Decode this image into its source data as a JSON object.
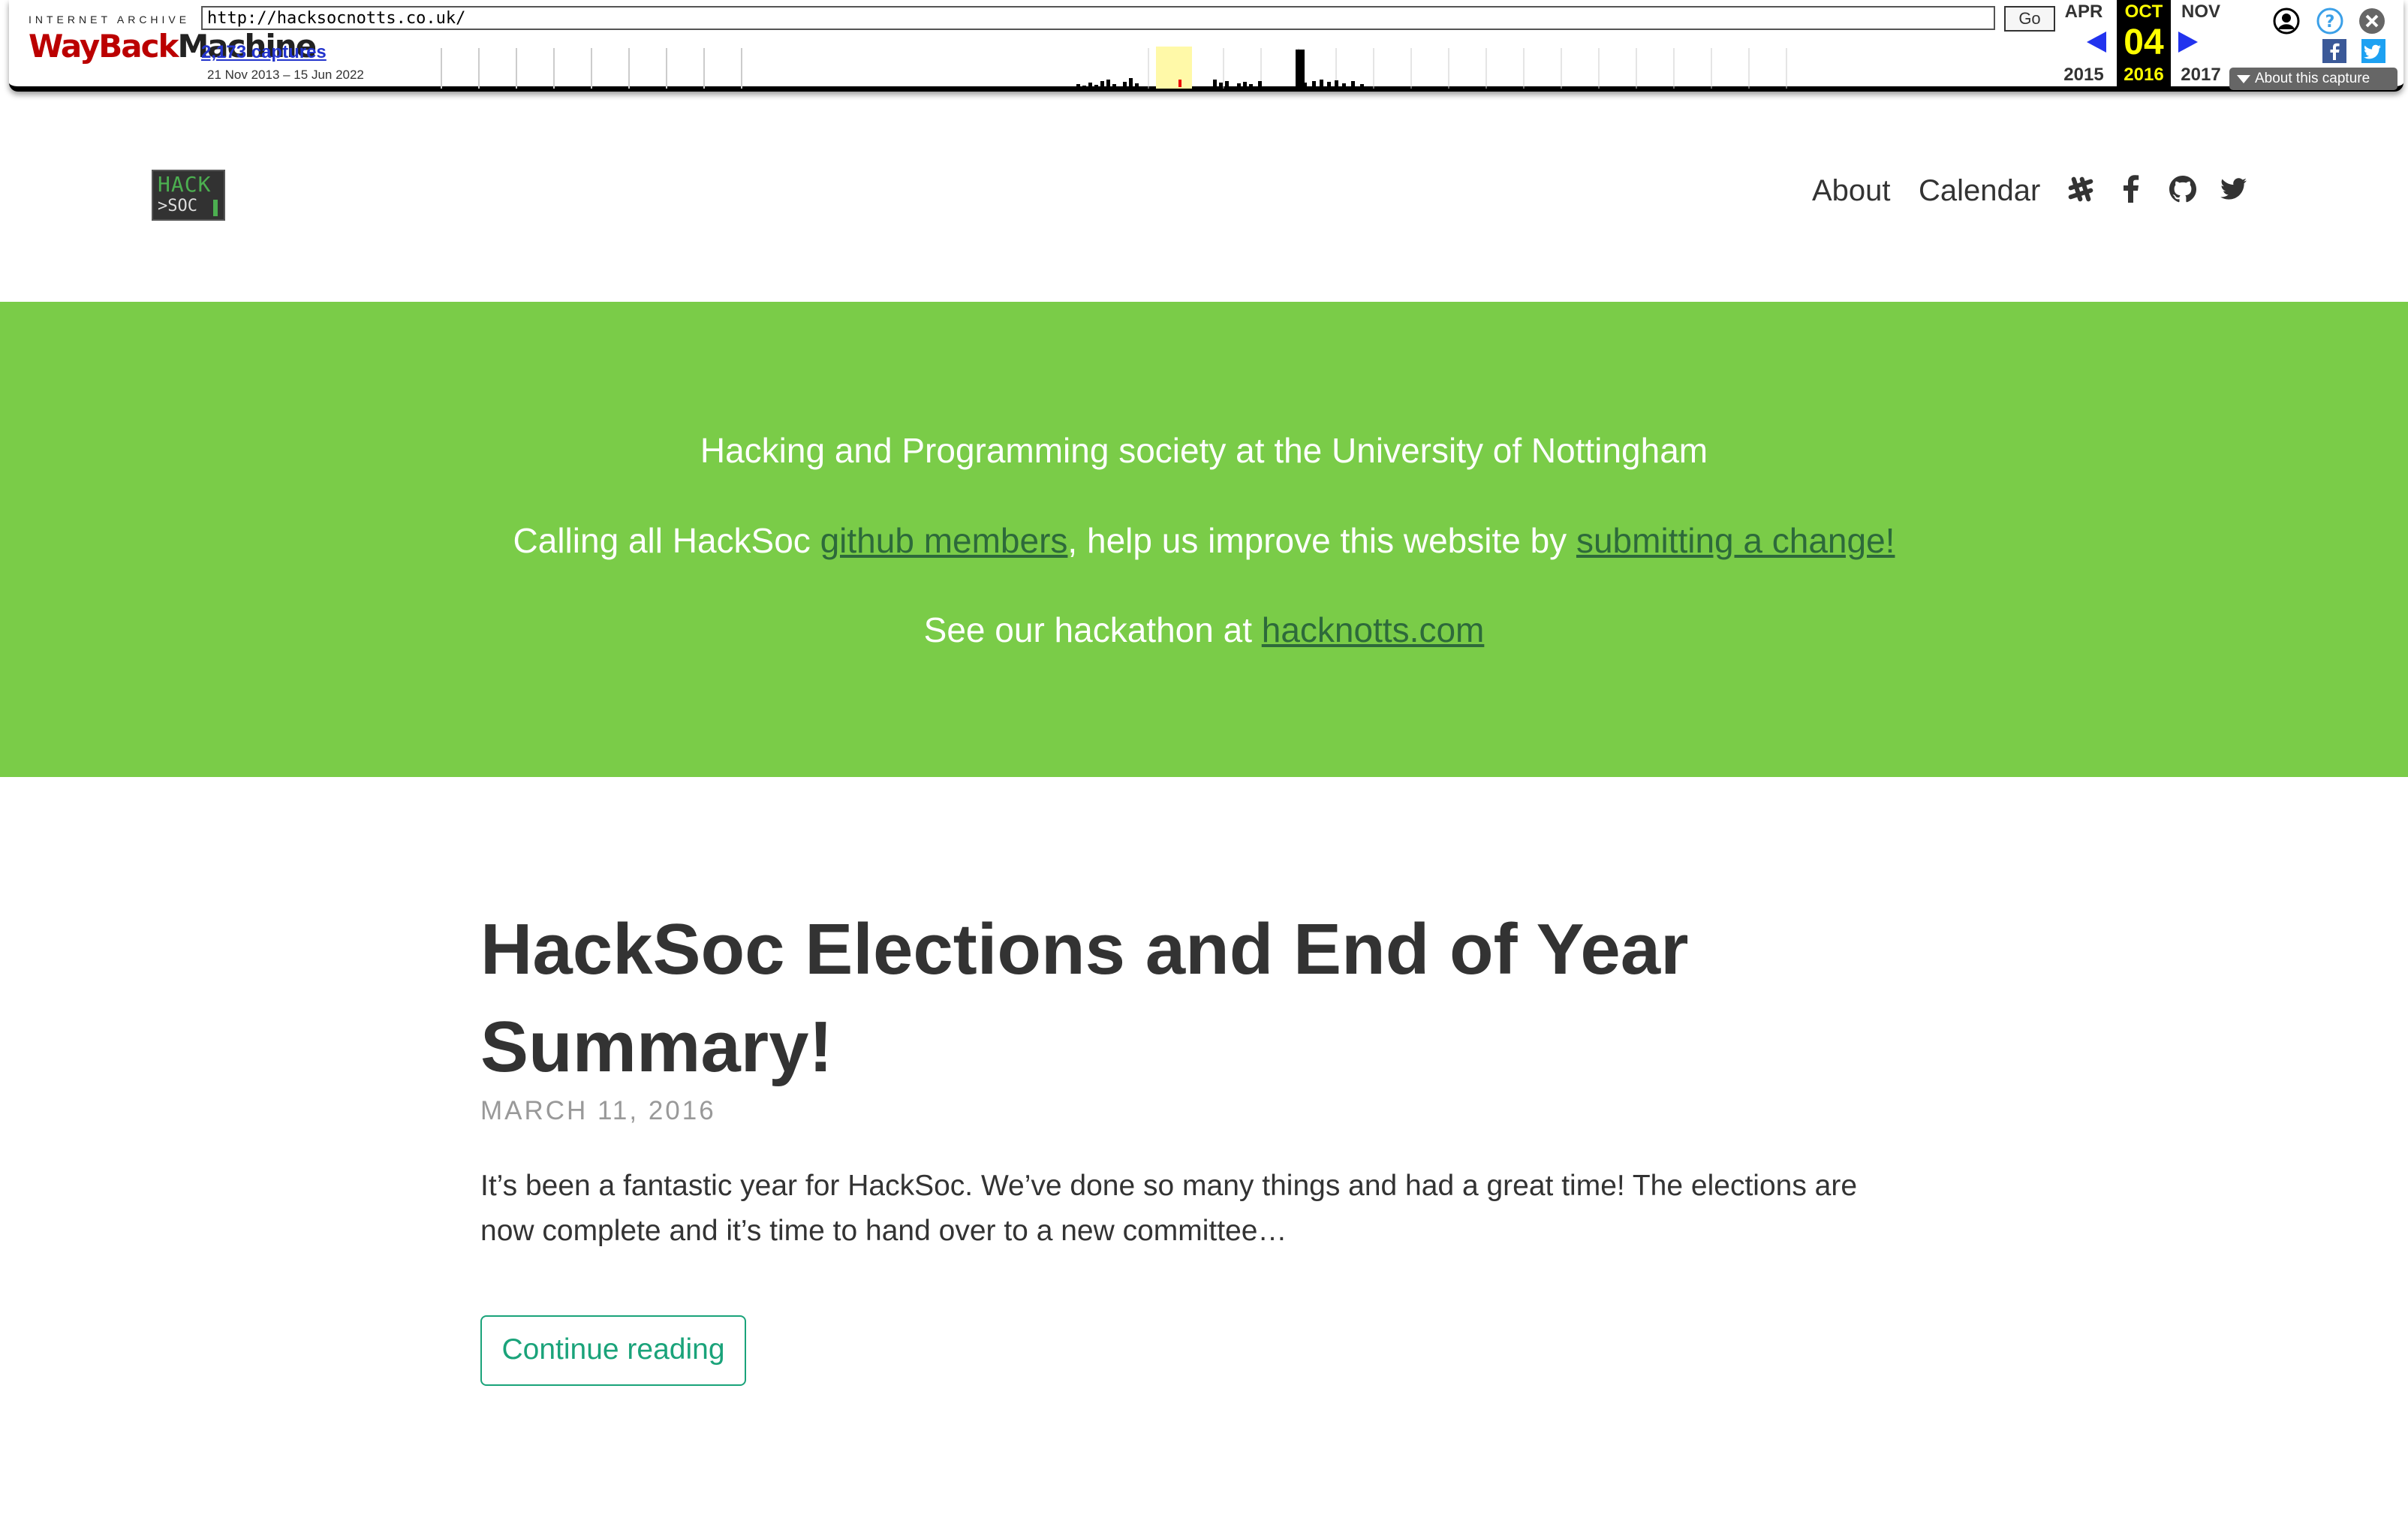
{
  "wayback": {
    "logo_top": "INTERNET ARCHIVE",
    "logo_way": "WayBack",
    "logo_machine": "Machine",
    "url_value": "http://hacksocnotts.co.uk/",
    "go_label": "Go",
    "captures_label": "2,173 captures",
    "date_range": "21 Nov 2013 – 15 Jun 2022",
    "calendar": {
      "prev_month": "APR",
      "cur_month": "OCT",
      "next_month": "NOV",
      "cur_day": "04",
      "prev_year": "2015",
      "cur_year": "2016",
      "next_year": "2017"
    },
    "about_capture_label": "About this capture",
    "icons": [
      "user-icon",
      "help-icon",
      "close-icon",
      "facebook-share-icon",
      "twitter-share-icon"
    ],
    "colors": {
      "highlight": "#ffff00",
      "arrow": "#2233ee",
      "captures_link": "#2233cc"
    }
  },
  "site": {
    "logo_hack": "HACK",
    "logo_soc": ">SOC",
    "nav": {
      "about": "About",
      "calendar": "Calendar"
    },
    "nav_icons": [
      "slack-icon",
      "facebook-icon",
      "github-icon",
      "twitter-icon"
    ]
  },
  "hero": {
    "tagline": "Hacking and Programming society at the University of Nottingham",
    "line2_prefix": "Calling all HackSoc ",
    "line2_link1": "github members",
    "line2_middle": ", help us improve this website by ",
    "line2_link2": "submitting a change!",
    "line3_prefix": "See our hackathon at ",
    "line3_link": "hacknotts.com",
    "colors": {
      "background": "#7acc48",
      "link": "#2d6a3a"
    }
  },
  "post": {
    "title": "HackSoc Elections and End of Year Summary!",
    "date": "MARCH 11, 2016",
    "excerpt": "It’s been a fantastic year for HackSoc. We’ve done so many things and had a great time! The elections are now complete and it’s time to hand over to a new committee…",
    "continue_label": "Continue reading",
    "colors": {
      "button": "#1aa37a"
    }
  }
}
